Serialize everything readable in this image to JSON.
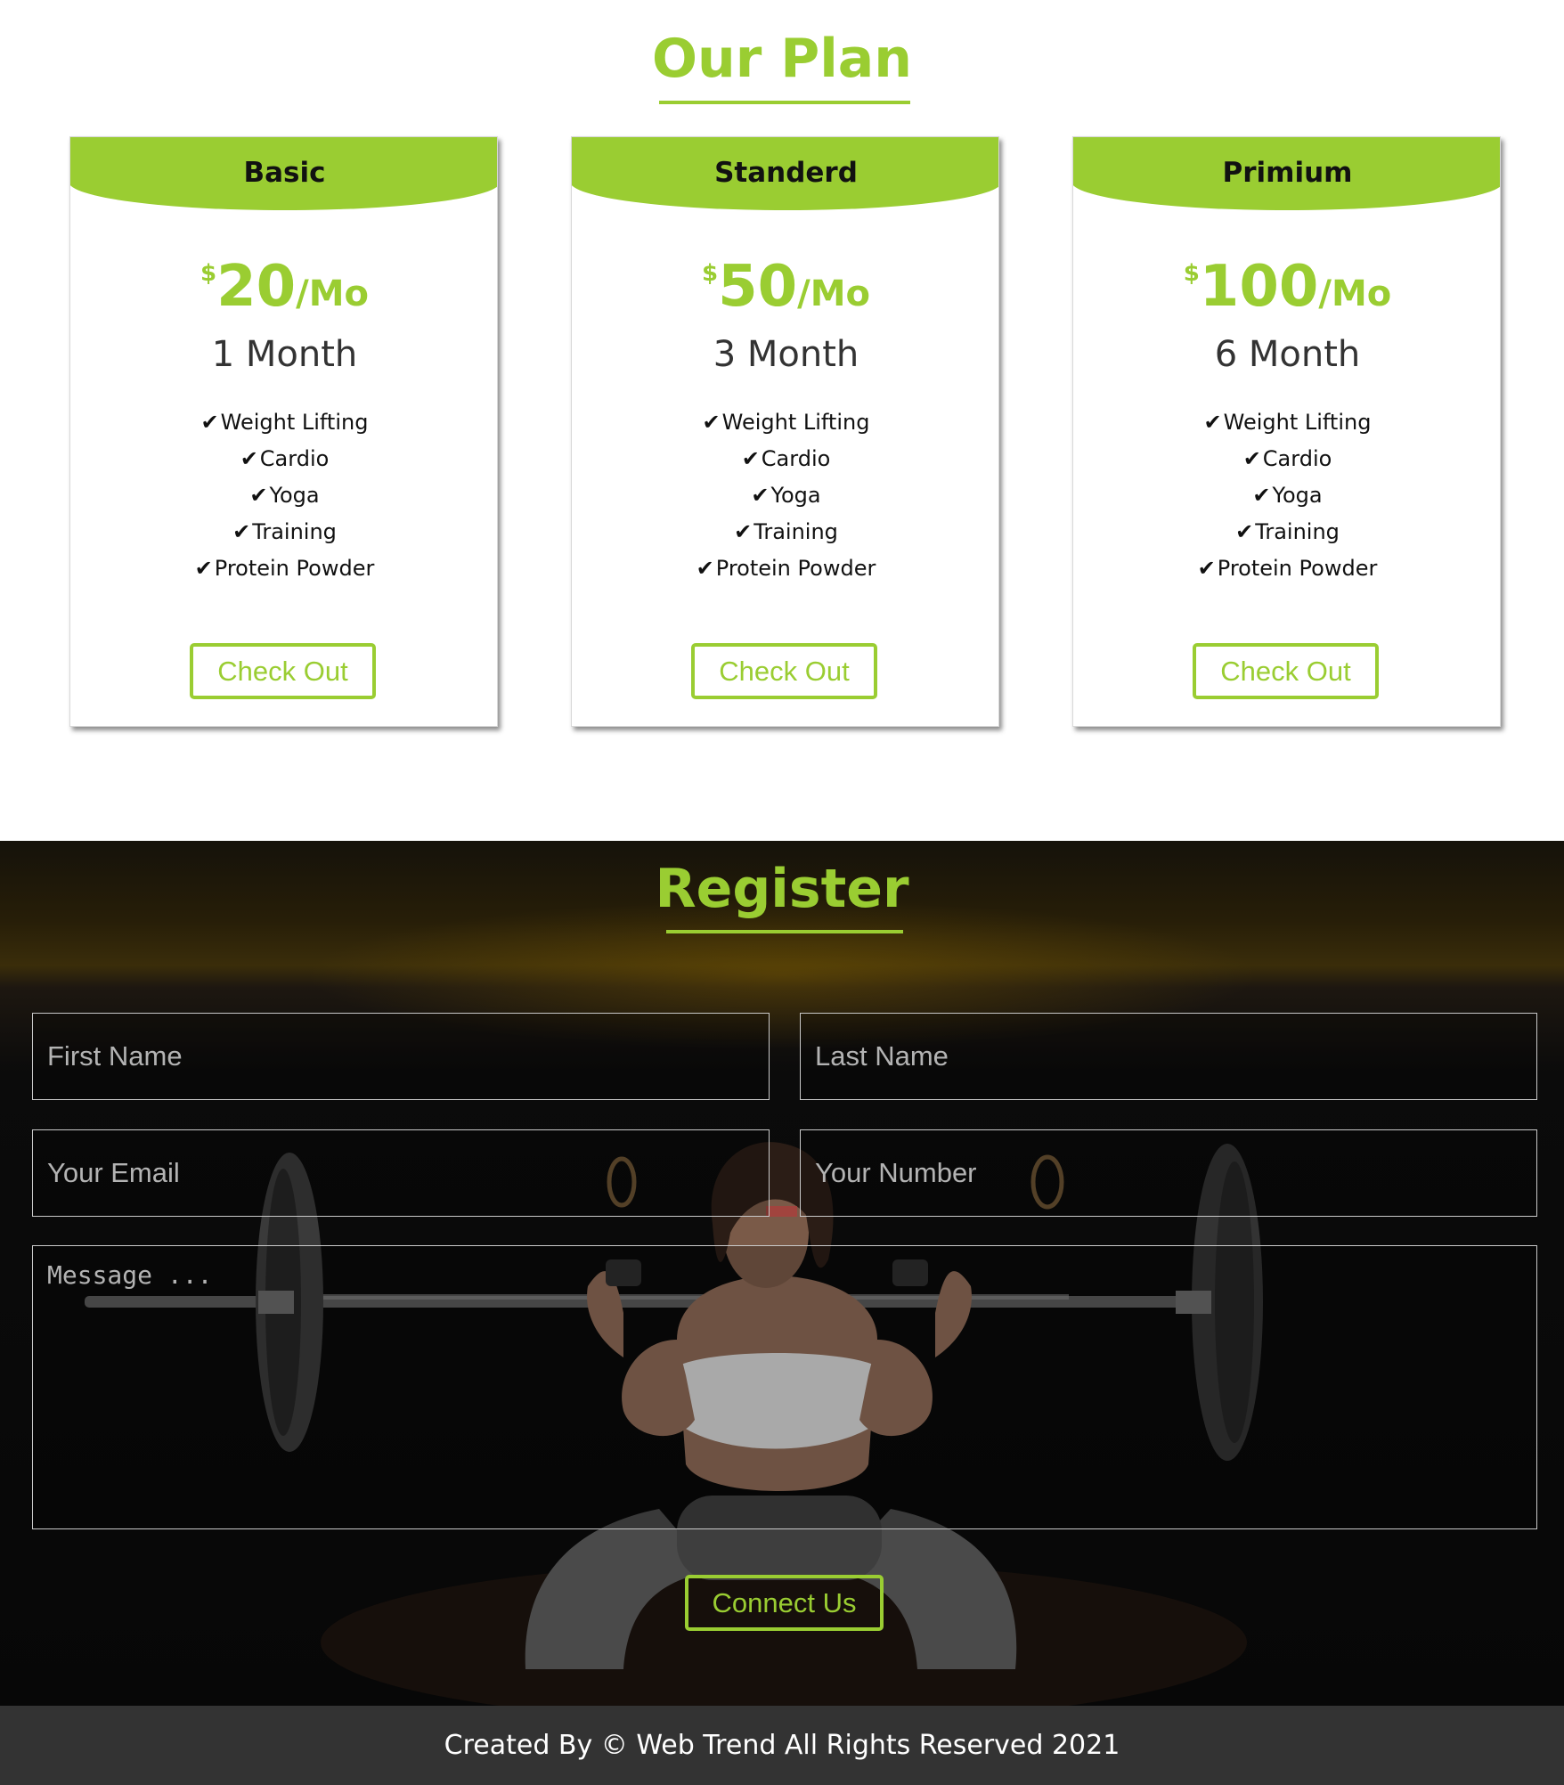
{
  "plans_section": {
    "title": "Our Plan",
    "plans": [
      {
        "name": "Basic",
        "currency": "$",
        "amount": "20",
        "period": "/Mo",
        "duration": "1 Month",
        "features": [
          "Weight Lifting",
          "Cardio",
          "Yoga",
          "Training",
          "Protein Powder"
        ],
        "button_label": "Check Out"
      },
      {
        "name": "Standerd",
        "currency": "$",
        "amount": "50",
        "period": "/Mo",
        "duration": "3 Month",
        "features": [
          "Weight Lifting",
          "Cardio",
          "Yoga",
          "Training",
          "Protein Powder"
        ],
        "button_label": "Check Out"
      },
      {
        "name": "Primium",
        "currency": "$",
        "amount": "100",
        "period": "/Mo",
        "duration": "6 Month",
        "features": [
          "Weight Lifting",
          "Cardio",
          "Yoga",
          "Training",
          "Protein Powder"
        ],
        "button_label": "Check Out"
      }
    ]
  },
  "register_section": {
    "title": "Register",
    "fields": {
      "first_name": {
        "placeholder": "First Name",
        "value": ""
      },
      "last_name": {
        "placeholder": "Last Name",
        "value": ""
      },
      "email": {
        "placeholder": "Your Email",
        "value": ""
      },
      "number": {
        "placeholder": "Your Number",
        "value": ""
      },
      "message": {
        "placeholder": "Message ...",
        "value": ""
      }
    },
    "submit_label": "Connect Us",
    "background_icon": "weightlifter-photo"
  },
  "footer": {
    "text": "Created By © Web Trend All Rights Reserved 2021"
  },
  "colors": {
    "accent": "#9acd32",
    "footer_bg": "#333333",
    "register_bg": "#0b0b0b"
  },
  "icons": {
    "feature_check": "check-icon"
  }
}
